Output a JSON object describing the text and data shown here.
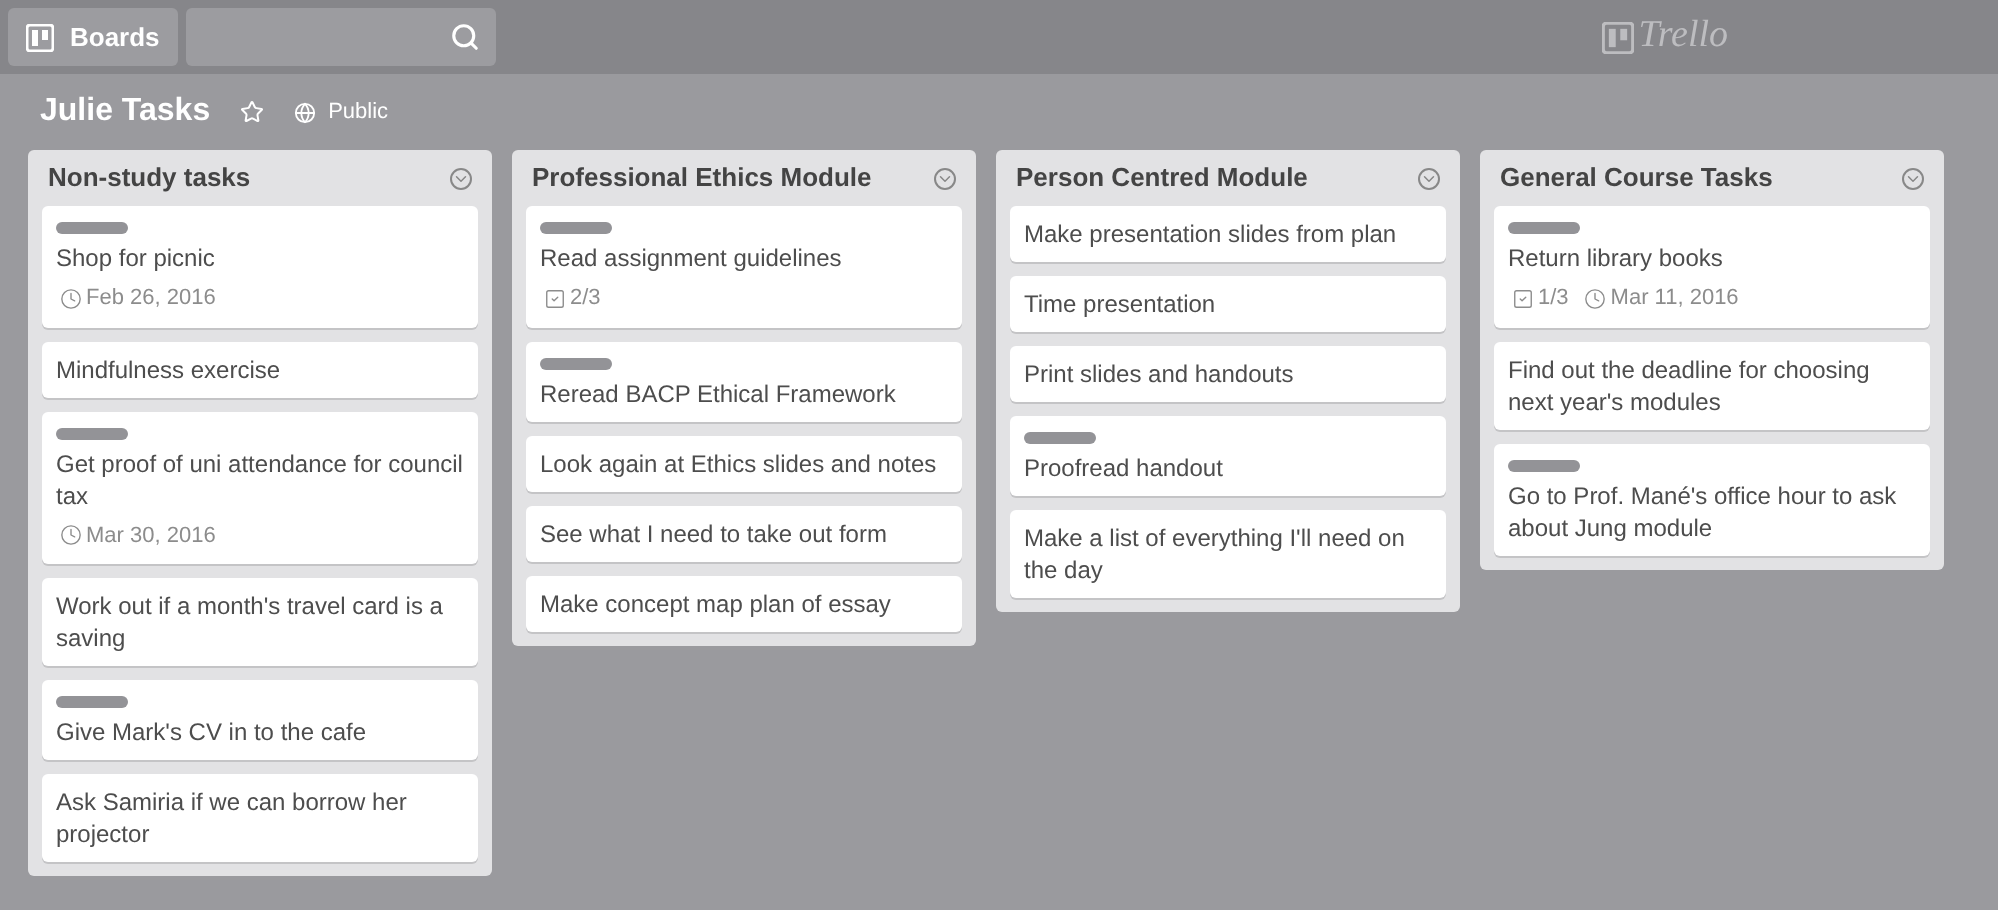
{
  "header": {
    "boards_button": "Boards",
    "logo": "Trello"
  },
  "board": {
    "title": "Julie Tasks",
    "starred": false,
    "visibility": "Public"
  },
  "lists": [
    {
      "title": "Non-study tasks",
      "cards": [
        {
          "title": "Shop for picnic",
          "labeled": true,
          "badges": [
            {
              "kind": "due",
              "text": "Feb 26, 2016"
            }
          ]
        },
        {
          "title": "Mindfulness exercise",
          "labeled": false
        },
        {
          "title": "Get proof of uni attendance for council tax",
          "labeled": true,
          "badges": [
            {
              "kind": "due",
              "text": "Mar 30, 2016"
            }
          ]
        },
        {
          "title": "Work out if a month's travel card is a saving",
          "labeled": false
        },
        {
          "title": "Give Mark's CV in to the cafe",
          "labeled": true
        },
        {
          "title": "Ask Samiria if we can borrow her projector",
          "labeled": false
        }
      ]
    },
    {
      "title": "Professional Ethics Module",
      "cards": [
        {
          "title": "Read assignment guidelines",
          "labeled": true,
          "badges": [
            {
              "kind": "checklist",
              "text": "2/3"
            }
          ]
        },
        {
          "title": "Reread BACP Ethical Framework",
          "labeled": true
        },
        {
          "title": "Look again at Ethics slides and notes",
          "labeled": false
        },
        {
          "title": "See what I need to take out form",
          "labeled": false
        },
        {
          "title": "Make concept map plan of essay",
          "labeled": false
        }
      ]
    },
    {
      "title": "Person Centred Module",
      "cards": [
        {
          "title": "Make presentation slides from plan",
          "labeled": false
        },
        {
          "title": "Time presentation",
          "labeled": false
        },
        {
          "title": "Print slides and handouts",
          "labeled": false
        },
        {
          "title": "Proofread handout",
          "labeled": true
        },
        {
          "title": "Make a list of everything I'll need on the day",
          "labeled": false
        }
      ]
    },
    {
      "title": "General Course Tasks",
      "cards": [
        {
          "title": "Return library books",
          "labeled": true,
          "badges": [
            {
              "kind": "checklist",
              "text": "1/3"
            },
            {
              "kind": "due",
              "text": "Mar 11, 2016"
            }
          ]
        },
        {
          "title": "Find out the deadline for choosing next year's modules",
          "labeled": false
        },
        {
          "title": "Go to Prof. Mané's office hour to ask about Jung module",
          "labeled": true
        }
      ]
    }
  ]
}
